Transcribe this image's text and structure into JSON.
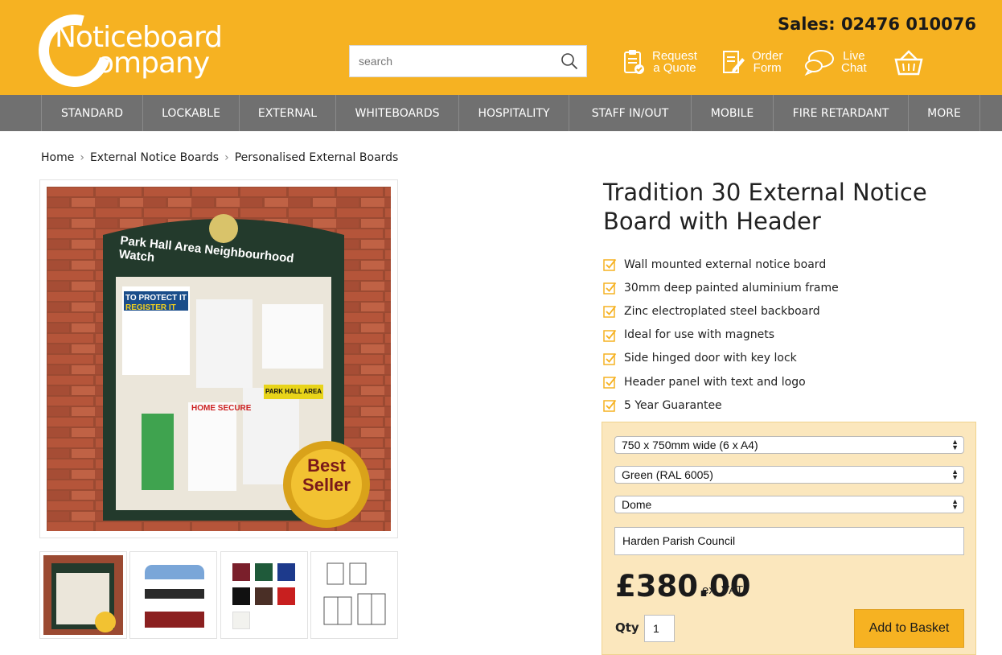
{
  "header": {
    "logo_line1": "Noticeboard",
    "logo_line2": "ompany",
    "sales": "Sales: 02476 010076",
    "search_placeholder": "search",
    "links": [
      {
        "line1": "Request",
        "line2": "a Quote",
        "icon": "quote-clipboard-icon"
      },
      {
        "line1": "Order",
        "line2": "Form",
        "icon": "order-form-icon"
      },
      {
        "line1": "Live",
        "line2": "Chat",
        "icon": "chat-bubbles-icon"
      }
    ],
    "basket_icon": "basket-icon",
    "accent": "#f6b222"
  },
  "nav": [
    "STANDARD",
    "LOCKABLE",
    "EXTERNAL",
    "WHITEBOARDS",
    "HOSPITALITY",
    "STAFF IN/OUT",
    "MOBILE",
    "FIRE RETARDANT",
    "MORE"
  ],
  "breadcrumb": [
    "Home",
    "External Notice Boards",
    "Personalised External Boards"
  ],
  "gallery": {
    "main": {
      "header_text": "Park Hall Area Neighbourhood Watch",
      "poster1_title": "TO PROTECT IT",
      "poster1_sub": "REGISTER IT",
      "poster2_title": "HOME SECURE",
      "poster3_title": "PARK HALL AREA",
      "badge_line1": "Best",
      "badge_line2": "Seller"
    },
    "thumb_count": 4
  },
  "product": {
    "title": "Tradition 30 External Notice Board with Header",
    "features": [
      "Wall mounted external notice board",
      "30mm deep painted aluminium frame",
      "Zinc electroplated steel backboard",
      "Ideal for use with magnets",
      "Side hinged door with key lock",
      "Header panel with text and logo",
      "5 Year Guarantee"
    ],
    "size_option": "750 x 750mm wide (6 x A4)",
    "colour_option": "Green (RAL 6005)",
    "header_option": "Dome",
    "header_text_value": "Harden Parish Council",
    "price": "£380.00",
    "vat_label": "ex. VAT",
    "qty_label": "Qty",
    "qty_value": "1",
    "add_button": "Add to Basket"
  }
}
